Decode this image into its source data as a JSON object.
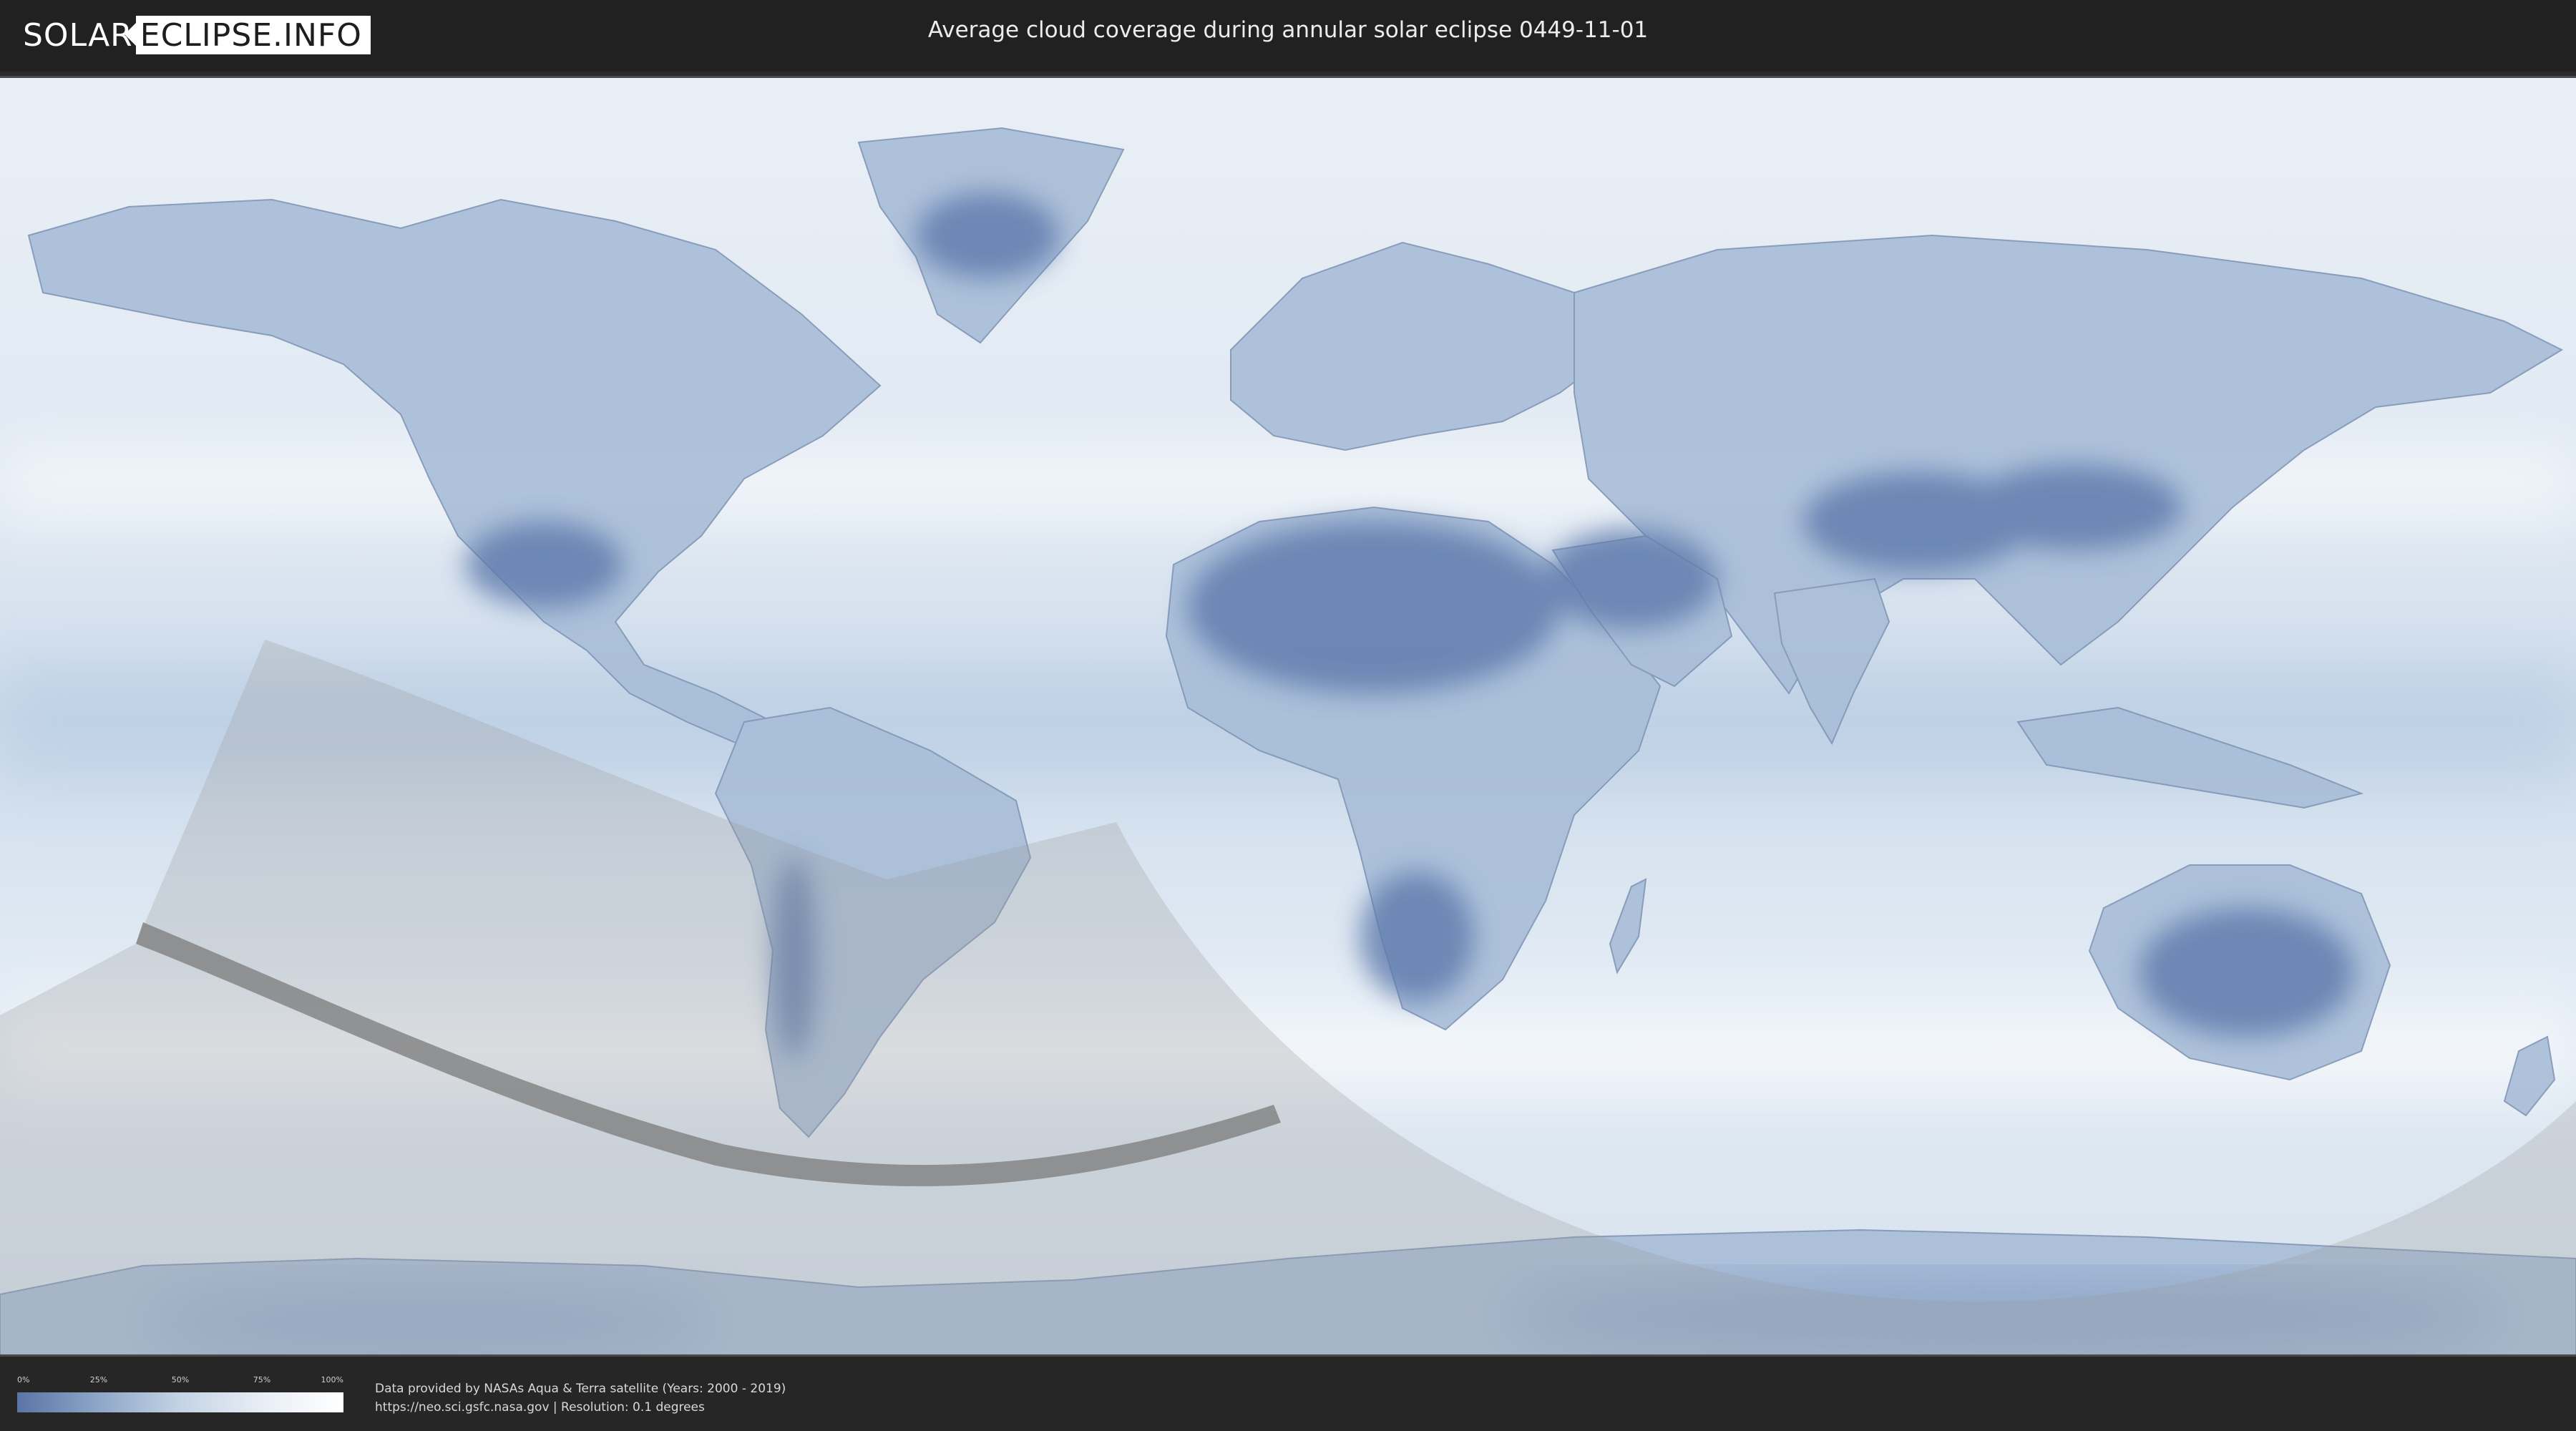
{
  "header": {
    "logo_left": "SOLAR",
    "logo_right": "ECLIPSE.INFO",
    "title": "Average cloud coverage during annular solar eclipse 0449-11-01"
  },
  "map": {
    "description_icon": "world-map",
    "colors": {
      "ocean": "#dfe8f1",
      "land_cloudfree": "#5d79ab",
      "eclipse_shadow": "#9a9a9a",
      "annular_path": "#7a7a7a"
    }
  },
  "legend": {
    "ticks": [
      "0%",
      "25%",
      "50%",
      "75%",
      "100%"
    ],
    "gradient": [
      "#5a75a6",
      "#8ea6c8",
      "#c4d3e5",
      "#e8eef5",
      "#ffffff"
    ]
  },
  "credits": {
    "line1": "Data provided by NASAs Aqua & Terra satellite (Years: 2000 - 2019)",
    "line2": "https://neo.sci.gsfc.nasa.gov | Resolution: 0.1 degrees"
  }
}
